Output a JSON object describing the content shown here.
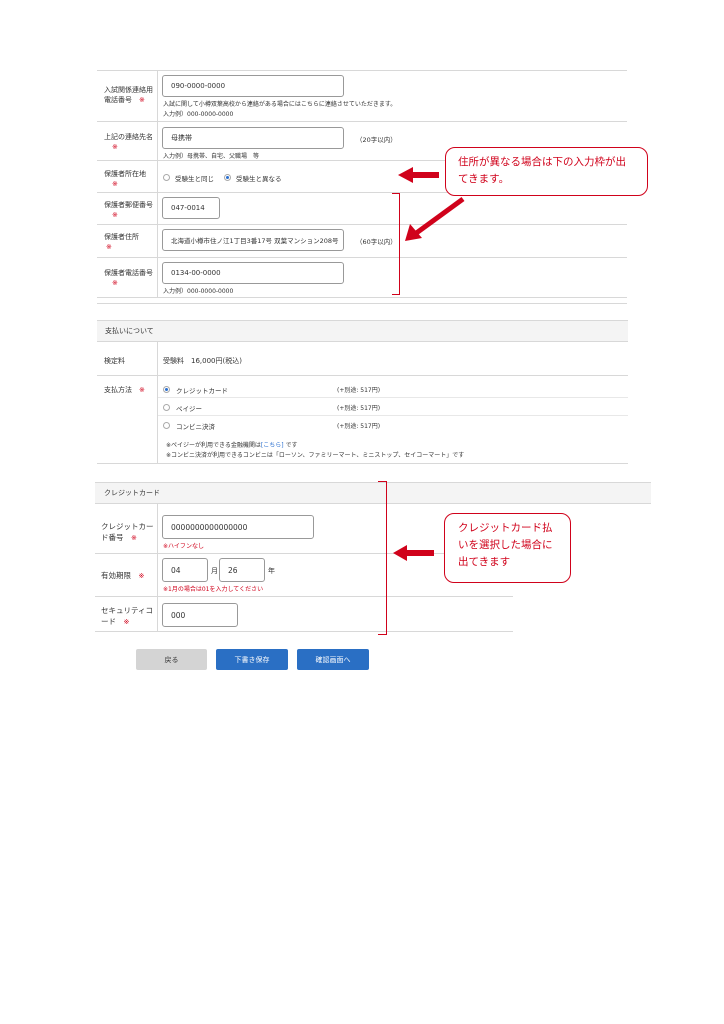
{
  "guardian": {
    "emergency_phone": {
      "label_line1": "入試関係連絡用",
      "label_line2": "電話番号",
      "required": "※",
      "value": "090-0000-0000",
      "note": "入試に関して小樽双葉高校から連絡がある場合にはこちらに連絡させていただきます。",
      "example": "入力例）000-0000-0000"
    },
    "contact_name": {
      "label": "上記の連絡先名",
      "required": "※",
      "value": "母携帯",
      "limit": "（20字以内）",
      "example": "入力例）母携帯、自宅、父職場　等"
    },
    "residence": {
      "label": "保護者所在地",
      "required": "※",
      "option_same": "受験生と同じ",
      "option_diff": "受験生と異なる",
      "selected": "option_diff"
    },
    "postal": {
      "label": "保護者郵便番号",
      "required": "※",
      "value": "047-0014"
    },
    "address": {
      "label": "保護者住所",
      "required": "※",
      "value": "北海道小樽市住ノ江1丁目3番17号 双葉マンション208号",
      "limit": "（60字以内）"
    },
    "phone": {
      "label": "保護者電話番号",
      "required": "※",
      "value": "0134-00-0000",
      "example": "入力例）000-0000-0000"
    }
  },
  "payment": {
    "section_title": "支払いについて",
    "fee_label": "検定料",
    "fee_value": "受験料　16,000円(税込)",
    "method_label": "支払方法",
    "required": "※",
    "methods": [
      {
        "label": "クレジットカード",
        "fee": "(+別途: 517円)",
        "selected": true
      },
      {
        "label": "ペイジー",
        "fee": "(+別途: 517円)",
        "selected": false
      },
      {
        "label": "コンビニ決済",
        "fee": "(+別途: 517円)",
        "selected": false
      }
    ],
    "note1_prefix": "※ペイジーが利用できる金融機関は",
    "note1_link": "[こちら]",
    "note1_suffix": " です",
    "note2": "※コンビニ決済が利用できるコンビニは「ローソン、ファミリーマート、ミニストップ、セイコーマート」です"
  },
  "credit": {
    "section_title": "クレジットカード",
    "card_label_line1": "クレジットカー",
    "card_label_line2": "ド番号",
    "required": "※",
    "card_value": "0000000000000000",
    "card_hint": "※ハイフンなし",
    "expiry_label": "有効期限",
    "month_value": "04",
    "month_unit": "月",
    "year_value": "26",
    "year_unit": "年",
    "expiry_hint": "※1月の場合は01を入力してください",
    "cvc_label_line1": "セキュリティコ",
    "cvc_label_line2": "ード",
    "cvc_value": "000"
  },
  "buttons": {
    "back": "戻る",
    "draft": "下書き保存",
    "confirm": "確認画面へ"
  },
  "callouts": {
    "address_line1": "住所が異なる場合は下の入力枠が出",
    "address_line2": "てきます。",
    "card_line1": "クレジットカード払",
    "card_line2": "いを選択した場合に",
    "card_line3": "出てきます"
  },
  "colors": {
    "accent_red": "#d0021b",
    "button_blue": "#2a6fc4",
    "button_gray": "#d4d4d4",
    "radio_blue": "#2a6fd0"
  }
}
